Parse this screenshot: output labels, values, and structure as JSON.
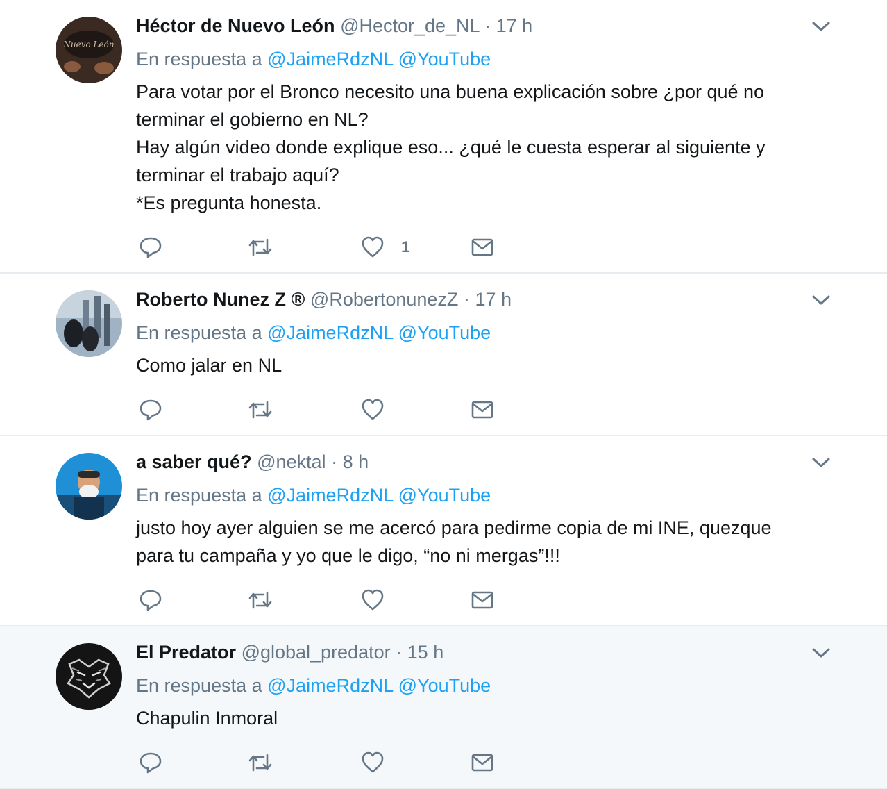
{
  "reply_prefix": "En respuesta a",
  "tweets": [
    {
      "fullname": "Héctor de Nuevo León",
      "username": "@Hector_de_NL",
      "dot": "·",
      "time": "17 h",
      "mentions": [
        "@JaimeRdzNL",
        "@YouTube"
      ],
      "text": [
        "Para votar por el Bronco necesito una buena explicación sobre ¿por qué no terminar el gobierno en NL?",
        "Hay algún video donde explique eso... ¿qué le cuesta esperar al siguiente y terminar el trabajo aquí?",
        "*Es pregunta honesta."
      ],
      "like_count": "1"
    },
    {
      "fullname": "Roberto Nunez Z ®",
      "username": "@RobertonunezZ",
      "dot": "·",
      "time": "17 h",
      "mentions": [
        "@JaimeRdzNL",
        "@YouTube"
      ],
      "text": [
        "Como jalar en NL"
      ],
      "like_count": ""
    },
    {
      "fullname": "a saber qué?",
      "username": "@nektal",
      "dot": "·",
      "time": "8 h",
      "mentions": [
        "@JaimeRdzNL",
        "@YouTube"
      ],
      "text": [
        "justo hoy ayer alguien se me acercó para pedirme copia de mi INE, quezque para tu campaña y yo que le digo, “no ni mergas”!!!"
      ],
      "like_count": ""
    },
    {
      "fullname": "El Predator",
      "username": "@global_predator",
      "dot": "·",
      "time": "15 h",
      "mentions": [
        "@JaimeRdzNL",
        "@YouTube"
      ],
      "text": [
        "Chapulin Inmoral"
      ],
      "like_count": ""
    }
  ],
  "icons": {
    "reply": "reply-icon",
    "retweet": "retweet-icon",
    "like": "heart-icon",
    "dm": "envelope-icon",
    "caret": "chevron-down-icon"
  },
  "colors": {
    "link": "#1da1f2",
    "secondary_text": "#657786",
    "primary_text": "#14171a",
    "divider": "#e6ecf0",
    "highlight_bg": "#f5f8fa"
  }
}
